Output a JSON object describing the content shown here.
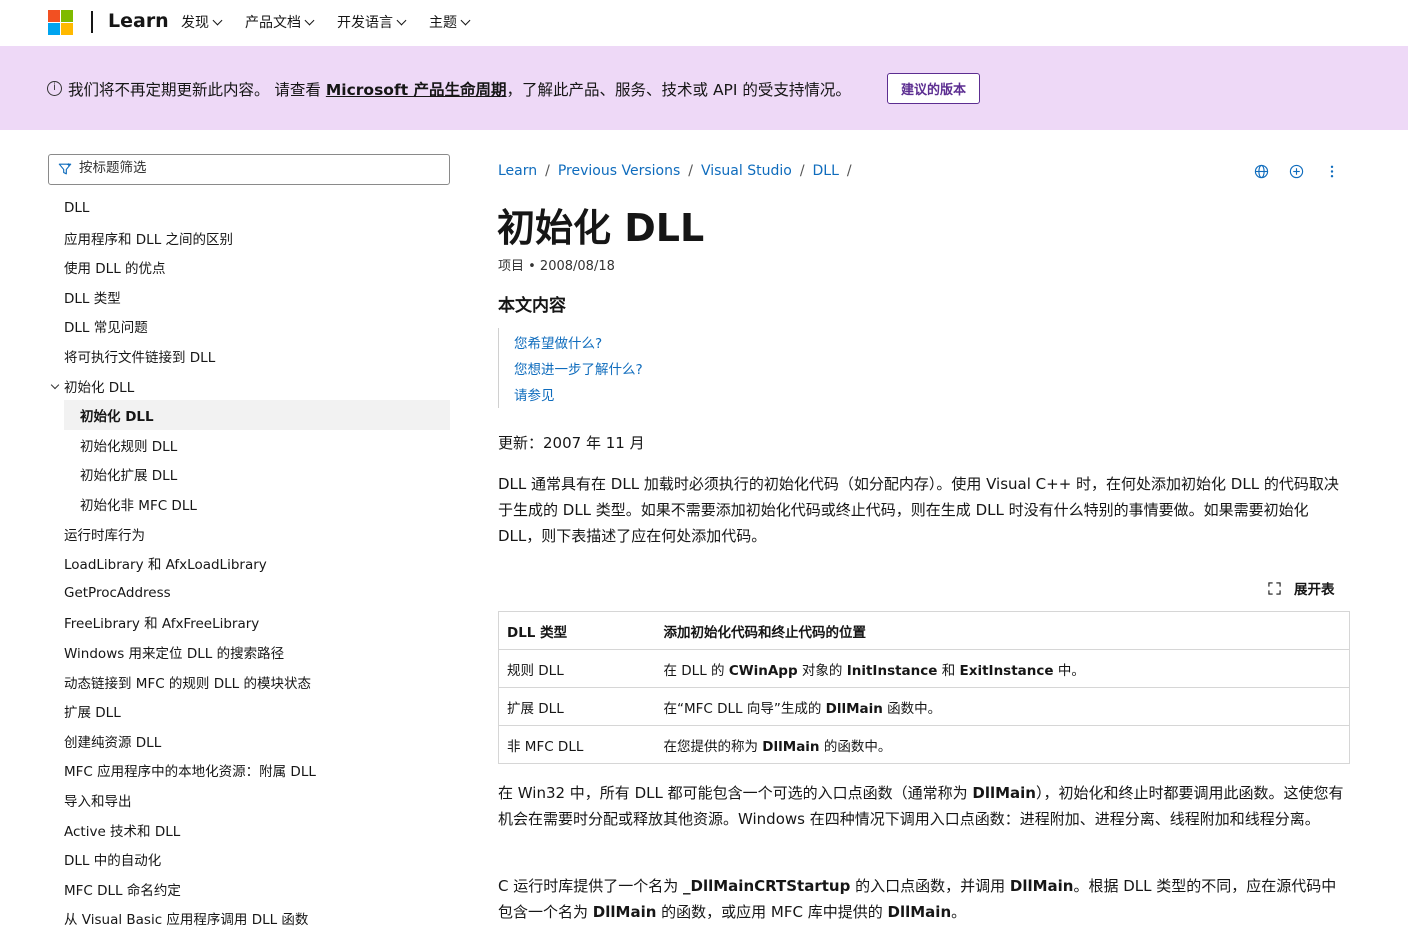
{
  "header": {
    "brand": "Learn",
    "logo_colors": [
      "#f25022",
      "#7fba00",
      "#00a4ef",
      "#ffb900"
    ],
    "nav": [
      {
        "label": "发现"
      },
      {
        "label": "产品文档"
      },
      {
        "label": "开发语言"
      },
      {
        "label": "主题"
      }
    ]
  },
  "banner": {
    "text_before": "我们将不再定期更新此内容。 请查看 ",
    "link": "Microsoft 产品生命周期",
    "text_after": "，了解此产品、服务、技术或 API 的受支持情况。",
    "button": "建议的版本",
    "background": "#eed9f7",
    "accent": "#5c2e91"
  },
  "sidebar": {
    "filter_placeholder": "按标题筛选",
    "items": [
      {
        "label": "DLL",
        "level": 0
      },
      {
        "label": "应用程序和 DLL 之间的区别",
        "level": 0
      },
      {
        "label": "使用 DLL 的优点",
        "level": 0
      },
      {
        "label": "DLL 类型",
        "level": 0
      },
      {
        "label": "DLL 常见问题",
        "level": 0
      },
      {
        "label": "将可执行文件链接到 DLL",
        "level": 0
      },
      {
        "label": "初始化 DLL",
        "level": 0,
        "expanded": true
      },
      {
        "label": "初始化 DLL",
        "level": 1,
        "active": true
      },
      {
        "label": "初始化规则 DLL",
        "level": 1
      },
      {
        "label": "初始化扩展 DLL",
        "level": 1
      },
      {
        "label": "初始化非 MFC DLL",
        "level": 1
      },
      {
        "label": "运行时库行为",
        "level": 0
      },
      {
        "label": "LoadLibrary 和 AfxLoadLibrary",
        "level": 0
      },
      {
        "label": "GetProcAddress",
        "level": 0
      },
      {
        "label": "FreeLibrary 和 AfxFreeLibrary",
        "level": 0
      },
      {
        "label": "Windows 用来定位 DLL 的搜索路径",
        "level": 0
      },
      {
        "label": "动态链接到 MFC 的规则 DLL 的模块状态",
        "level": 0
      },
      {
        "label": "扩展 DLL",
        "level": 0
      },
      {
        "label": "创建纯资源 DLL",
        "level": 0
      },
      {
        "label": "MFC 应用程序中的本地化资源：附属 DLL",
        "level": 0
      },
      {
        "label": "导入和导出",
        "level": 0
      },
      {
        "label": "Active 技术和 DLL",
        "level": 0
      },
      {
        "label": "DLL 中的自动化",
        "level": 0
      },
      {
        "label": "MFC DLL 命名约定",
        "level": 0
      },
      {
        "label": "从 Visual Basic 应用程序调用 DLL 函数",
        "level": 0
      }
    ]
  },
  "breadcrumb": [
    "Learn",
    "Previous Versions",
    "Visual Studio",
    "DLL"
  ],
  "breadcrumb_actions": [
    "globe-icon",
    "add-circle-icon",
    "more-icon"
  ],
  "article": {
    "title": "初始化 DLL",
    "meta": "项目 • 2008/08/18",
    "in_this_article": "本文内容",
    "inpage_links": [
      "您希望做什么?",
      "您想进一步了解什么?",
      "请参见"
    ],
    "updated": "更新：2007 年 11 月",
    "intro": "DLL 通常具有在 DLL 加载时必须执行的初始化代码（如分配内存）。使用 Visual C++ 时，在何处添加初始化 DLL 的代码取决于生成的 DLL 类型。如果不需要添加初始化代码或终止代码，则在生成 DLL 时没有什么特别的事情要做。如果需要初始化 DLL，则下表描述了应在何处添加代码。",
    "expand_table": "展开表",
    "table": {
      "headers": [
        "DLL 类型",
        "添加初始化代码和终止代码的位置"
      ],
      "rows": [
        {
          "type": "规则 DLL",
          "p1": "在 DLL 的 ",
          "b1": "CWinApp",
          "p2": " 对象的 ",
          "b2": "InitInstance",
          "p3": " 和 ",
          "b3": "ExitInstance",
          "p4": " 中。"
        },
        {
          "type": "扩展 DLL",
          "p1": "在“MFC DLL 向导”生成的 ",
          "b1": "DllMain",
          "p2": " 函数中。",
          "b2": "",
          "p3": "",
          "b3": "",
          "p4": ""
        },
        {
          "type": "非 MFC DLL",
          "p1": "在您提供的称为 ",
          "b1": "DllMain",
          "p2": " 的函数中。",
          "b2": "",
          "p3": "",
          "b3": "",
          "p4": ""
        }
      ]
    },
    "para2": {
      "p1": "在 Win32 中，所有 DLL 都可能包含一个可选的入口点函数（通常称为 ",
      "b1": "DllMain",
      "p2": "），初始化和终止时都要调用此函数。这使您有机会在需要时分配或释放其他资源。Windows 在四种情况下调用入口点函数：进程附加、进程分离、线程附加和线程分离。"
    },
    "para3": {
      "p1": "C 运行时库提供了一个名为 ",
      "b1": "_DllMainCRTStartup",
      "p2": " 的入口点函数，并调用 ",
      "b2": "DllMain",
      "p3": "。根据 DLL 类型的不同，应在源代码中包含一个名为 ",
      "b3": "DllMain",
      "p4": " 的函数，或应用 MFC 库中提供的 ",
      "b4": "DllMain",
      "p5": "。"
    }
  },
  "colors": {
    "link": "#0f6cbd",
    "text": "#161616",
    "active_bg": "#f2f2f2"
  }
}
